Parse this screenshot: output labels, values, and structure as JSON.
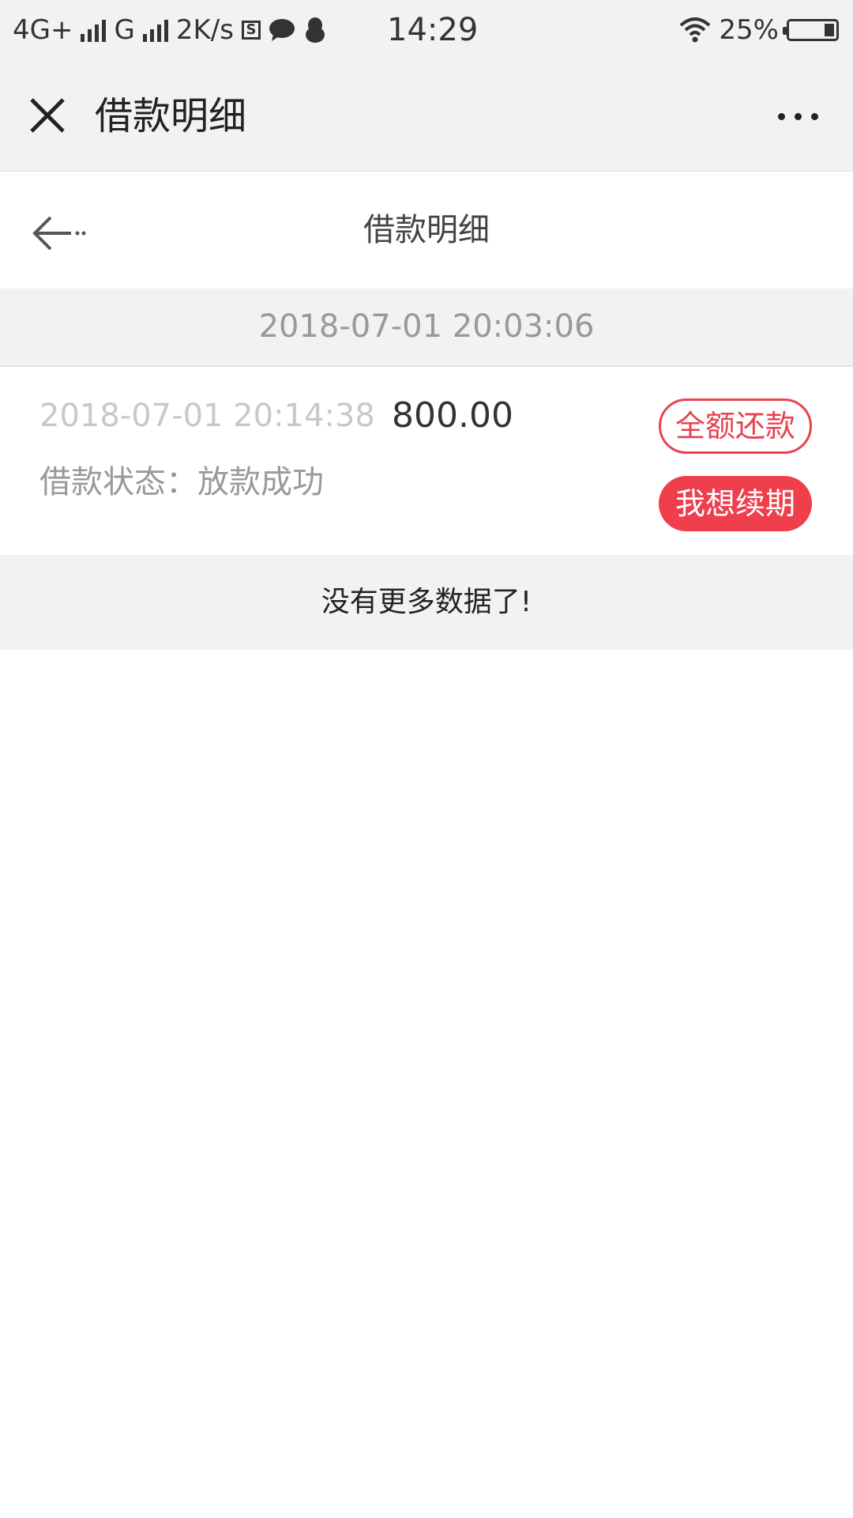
{
  "status_bar": {
    "network1": "4G+",
    "network2": "G",
    "speed": "2K/s",
    "sim_icon_letter": "S",
    "time": "14:29",
    "battery": "25%",
    "icons": [
      "signal-icon",
      "sim-icon",
      "chat-bubble-icon",
      "qq-penguin-icon",
      "wifi-icon",
      "battery-icon"
    ]
  },
  "header": {
    "title": "借款明细",
    "close_icon": "close-icon",
    "more_icon": "more-dots-icon"
  },
  "page": {
    "title": "借款明细",
    "back_icon": "back-arrow-icon"
  },
  "group": {
    "date": "2018-07-01 20:03:06"
  },
  "loan": {
    "time": "2018-07-01 20:14:38",
    "amount": "800.00",
    "status": "借款状态：放款成功",
    "repay_label": "全额还款",
    "extend_label": "我想续期"
  },
  "footer": {
    "no_more": "没有更多数据了!"
  },
  "colors": {
    "accent": "#ef3e4c",
    "header_bg": "#f2f2f2"
  }
}
